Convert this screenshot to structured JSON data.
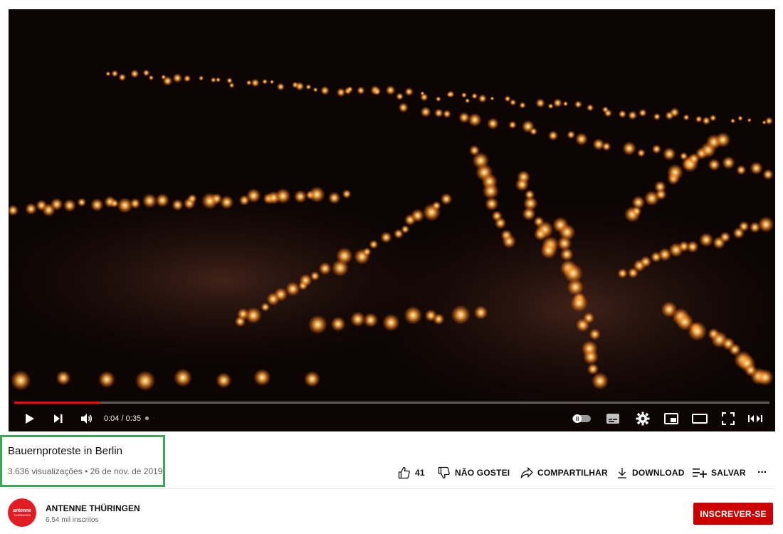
{
  "video": {
    "progress": 0.114,
    "current_time": "0:04",
    "separator": " / ",
    "duration": "0:35",
    "controls": [
      "play-icon",
      "next-icon",
      "volume-icon",
      "autoplay-toggle-icon",
      "subtitles-icon",
      "settings-icon",
      "miniplayer-icon",
      "theater-mode-icon",
      "fullscreen-icon",
      "cast-icon"
    ]
  },
  "info": {
    "title": "Bauernproteste in Berlin",
    "views": "3.636 visualizações",
    "dot": " • ",
    "date": "26 de nov. de 2019"
  },
  "actions": {
    "like_count": "41",
    "dislike_label": "NÃO GOSTEI",
    "share_label": "COMPARTILHAR",
    "download_label": "DOWNLOAD",
    "save_label": "SALVAR",
    "more": "···"
  },
  "channel": {
    "name": "ANTENNE THÜRINGEN",
    "subscribers": "6,54 mil inscritos",
    "logo_top": "antenne",
    "logo_bottom": "THÜRINGEN",
    "subscribe_label": "INSCREVER-SE"
  },
  "colors": {
    "accent_red": "#cc0000",
    "progress_red": "#ff0000",
    "highlight_green": "#3aa757"
  }
}
